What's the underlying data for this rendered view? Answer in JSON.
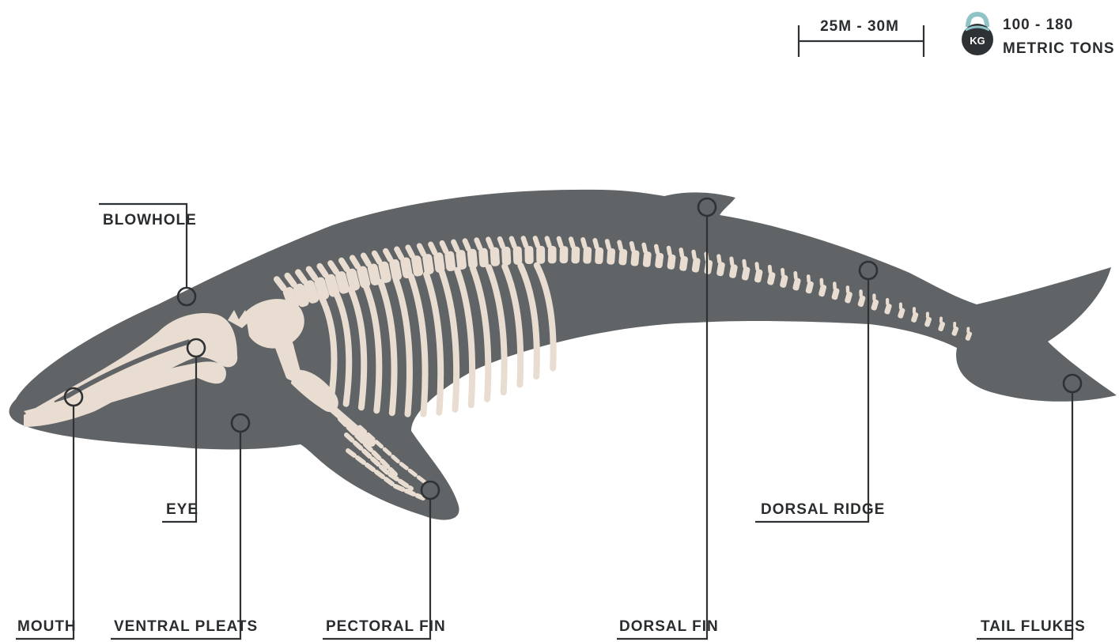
{
  "header": {
    "length_label": "25M - 30M",
    "weight_line1": "100 - 180",
    "weight_line2": "METRIC TONS",
    "weight_icon_text": "KG",
    "weight_icon": "kettlebell-icon"
  },
  "labels": {
    "blowhole": "BLOWHOLE",
    "eye": "EYE",
    "mouth": "MOUTH",
    "ventral_pleats": "VENTRAL PLEATS",
    "pectoral_fin": "PECTORAL FIN",
    "dorsal_fin": "DORSAL FIN",
    "dorsal_ridge": "DORSAL RIDGE",
    "tail_flukes": "TAIL FLUKES"
  },
  "colors": {
    "body": "#616466",
    "bone": "#e8ddd0",
    "line": "#2f3234",
    "text": "#2a2d2f",
    "kettlebell_handle": "#8fc3c8"
  }
}
